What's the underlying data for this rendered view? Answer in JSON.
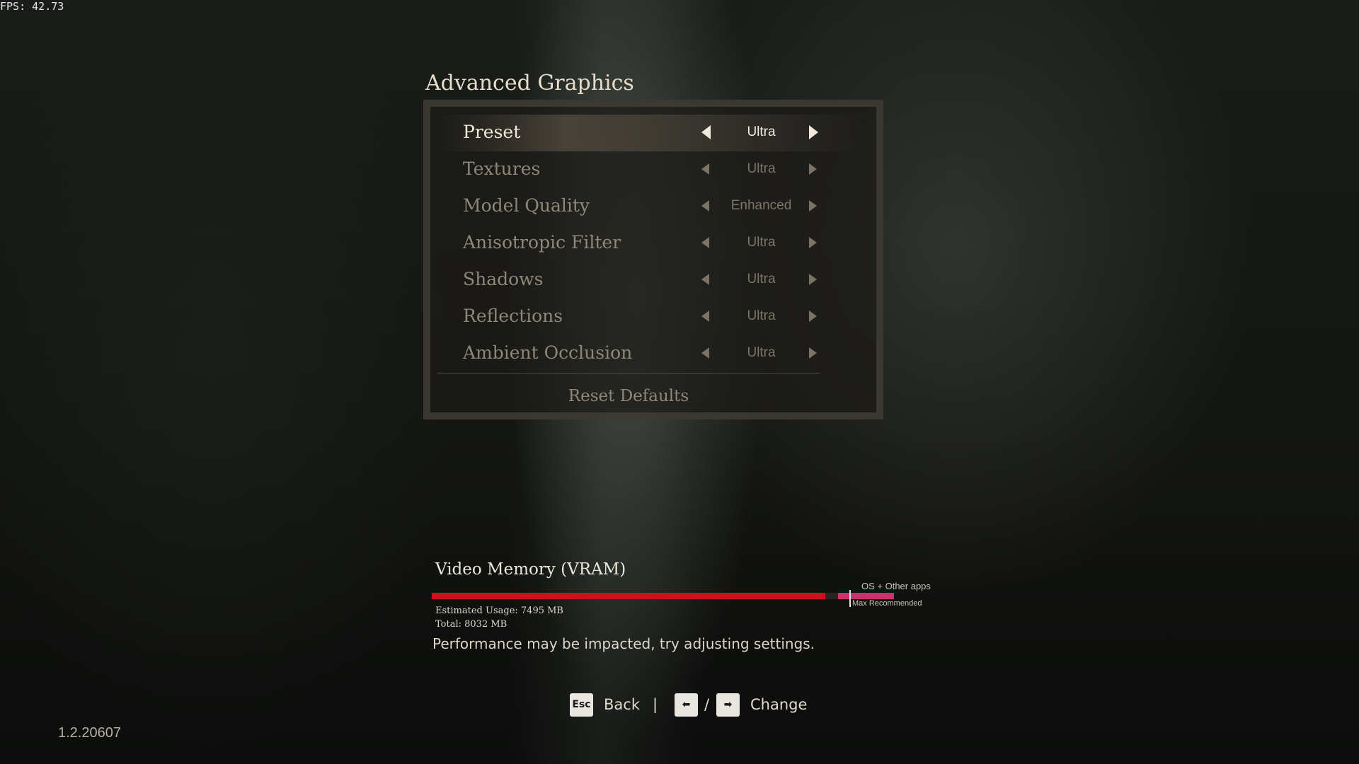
{
  "hud": {
    "fps": "FPS: 42.73"
  },
  "menu": {
    "title": "Advanced Graphics",
    "rows": [
      {
        "label": "Preset",
        "value": "Ultra",
        "selected": true
      },
      {
        "label": "Textures",
        "value": "Ultra"
      },
      {
        "label": "Model Quality",
        "value": "Enhanced"
      },
      {
        "label": "Anisotropic Filter",
        "value": "Ultra"
      },
      {
        "label": "Shadows",
        "value": "Ultra"
      },
      {
        "label": "Reflections",
        "value": "Ultra"
      },
      {
        "label": "Ambient Occlusion",
        "value": "Ultra"
      }
    ],
    "reset_label": "Reset Defaults"
  },
  "vram": {
    "title": "Video Memory (VRAM)",
    "usage_label": "Estimated Usage: 7495 MB",
    "total_label": "Total: 8032 MB",
    "estimated_usage_mb": 7495,
    "total_mb": 8032,
    "os_label": "OS + Other apps",
    "max_label": "Max Recommended",
    "warning": "Performance may be impacted, try adjusting settings.",
    "colors": {
      "usage": "#c8121c",
      "os": "#c2356e"
    }
  },
  "footer": {
    "back_key": "Esc",
    "back_label": "Back",
    "separator": "|",
    "left_key": "⬅",
    "slash": "/",
    "right_key": "➡",
    "change_label": "Change"
  },
  "version": "1.2.20607"
}
